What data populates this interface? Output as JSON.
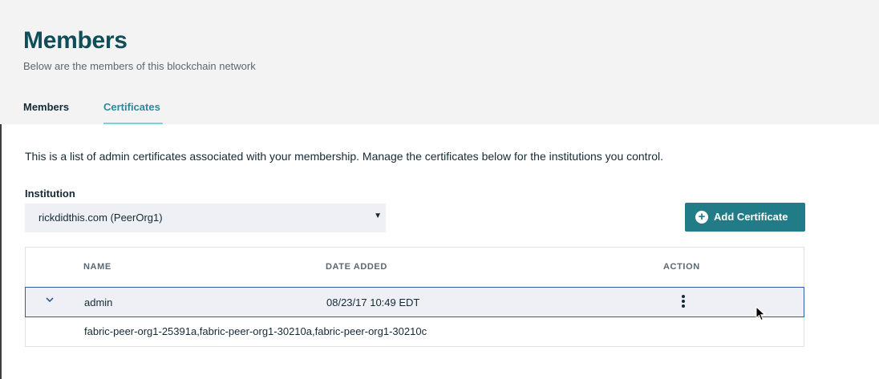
{
  "header": {
    "title": "Members",
    "subtitle": "Below are the members of this blockchain network",
    "tabs": [
      {
        "label": "Members",
        "active": false
      },
      {
        "label": "Certificates",
        "active": true
      }
    ]
  },
  "certificates": {
    "intro": "This is a list of admin certificates associated with your membership. Manage the certificates below for the institutions you control.",
    "institution_label": "Institution",
    "institution_selected": "rickdidthis.com (PeerOrg1)",
    "add_button_label": "Add Certificate",
    "table": {
      "columns": [
        "NAME",
        "DATE ADDED",
        "ACTION"
      ],
      "rows": [
        {
          "name": "admin",
          "date_added": "08/23/17 10:49 EDT",
          "expanded": true,
          "detail": "fabric-peer-org1-25391a,fabric-peer-org1-30210a,fabric-peer-org1-30210c"
        }
      ]
    }
  },
  "colors": {
    "title": "#0f4d59",
    "accent": "#217c87",
    "active_tab": "#2b8a9a",
    "row_selected_border": "#2b5ea7"
  },
  "icons": {
    "expand": "chevron-down-icon",
    "add": "plus-circle-icon",
    "row_menu": "overflow-menu-icon",
    "pointer": "mouse-cursor-icon"
  }
}
